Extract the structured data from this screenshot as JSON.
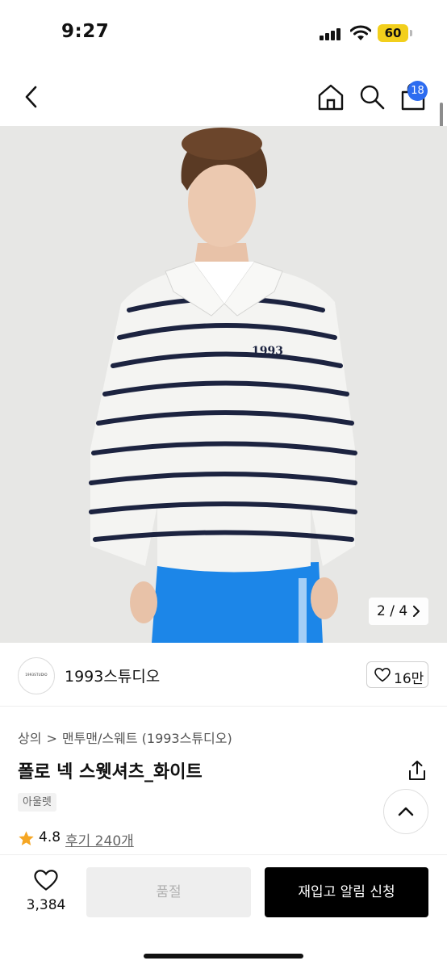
{
  "status": {
    "time": "9:27",
    "battery": "60"
  },
  "nav": {
    "cart_count": "18"
  },
  "gallery": {
    "counter": "2 / 4",
    "logo_text": "1993"
  },
  "brand": {
    "name": "1993스튜디오",
    "logo_text": "1993STUDIO",
    "likes": "16만"
  },
  "breadcrumb": {
    "level1": "상의",
    "separator": ">",
    "level2": "맨투맨/스웨트 (1993스튜디오)"
  },
  "product": {
    "title": "폴로 넥 스웻셔츠_화이트",
    "tag": "아울렛",
    "rating": "4.8",
    "reviews": "후기 240개"
  },
  "actions": {
    "wish_count": "3,384",
    "soldout_label": "품절",
    "restock_label": "재입고 알림 신청"
  },
  "colors": {
    "accent_blue": "#2d6cf0",
    "battery_yellow": "#f2cf1c",
    "star": "#f5a623",
    "pants_blue": "#1c86e8",
    "stripe_navy": "#1c2340"
  }
}
